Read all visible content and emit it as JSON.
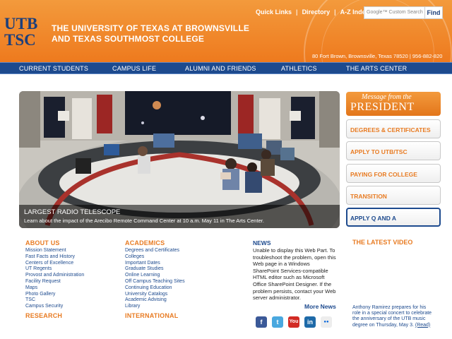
{
  "header": {
    "logo_line1": "UTB",
    "logo_line2": "TSC",
    "title_line1": "THE UNIVERSITY OF TEXAS AT BROWNSVILLE",
    "title_line2": "AND TEXAS SOUTHMOST COLLEGE",
    "links": [
      "Quick Links",
      "Directory",
      "A-Z Index"
    ],
    "search_placeholder": "Google™ Custom Search",
    "find_label": "Find",
    "address": "80 Fort Brown, Brownsville, Texas 78520 | 956-882-820"
  },
  "nav": [
    "CURRENT STUDENTS",
    "CAMPUS LIFE",
    "ALUMNI AND FRIENDS",
    "ATHLETICS",
    "THE ARTS CENTER"
  ],
  "hero": {
    "title": "LARGEST RADIO TELESCOPE",
    "text": "Learn about the impact of the Arecibo Remote Command Center at 10 a.m. May 11 in The Arts Center."
  },
  "sidebar": {
    "message_line1": "Message from the",
    "message_line2": "PRESIDENT",
    "buttons": [
      "DEGREES & CERTIFICATES",
      "APPLY TO UTB/TSC",
      "PAYING FOR COLLEGE",
      "TRANSITION",
      "APPLY Q AND A"
    ]
  },
  "about": {
    "heading": "ABOUT US",
    "items": [
      "Mission Statement",
      "Fast Facts and History",
      "Centers of Excellence",
      "UT Regents",
      "Provost and Administration",
      "Facility Request",
      "Maps",
      "Photo Gallery",
      "TSC",
      "Campus Security"
    ]
  },
  "research": {
    "heading": "RESEARCH"
  },
  "academics": {
    "heading": "ACADEMICS",
    "items": [
      "Degrees and Certificates",
      "Colleges",
      "Important Dates",
      "Graduate Studies",
      "Online Learning",
      "Off Campus Teaching Sites",
      "Continuing Education",
      "University Catalogs",
      "Academic Advising",
      "Library"
    ]
  },
  "international": {
    "heading": "INTERNATIONAL"
  },
  "news": {
    "heading": "NEWS",
    "body": "Unable to display this Web Part. To troubleshoot the problem, open this Web page in a Windows SharePoint Services-compatible HTML editor such as Microsoft Office SharePoint Designer. If the problem persists, contact your Web server administrator.",
    "more": "More News"
  },
  "social": [
    {
      "icon": "facebook-icon",
      "glyph": "f",
      "color": "#3b5998"
    },
    {
      "icon": "twitter-icon",
      "glyph": "t",
      "color": "#4aa8df"
    },
    {
      "icon": "youtube-icon",
      "glyph": "You",
      "color": "#d22b24"
    },
    {
      "icon": "linkedin-icon",
      "glyph": "in",
      "color": "#1e6aa8"
    },
    {
      "icon": "flickr-icon",
      "glyph": "●●",
      "color": "#6a6aa0"
    }
  ],
  "video": {
    "heading": "THE LATEST VIDEO",
    "text": "Anthony Ramirez prepares for his role in a special concert to celebrate the anniversary of the UTB music degree on Thursday, May 3.",
    "read": "(Read)"
  }
}
